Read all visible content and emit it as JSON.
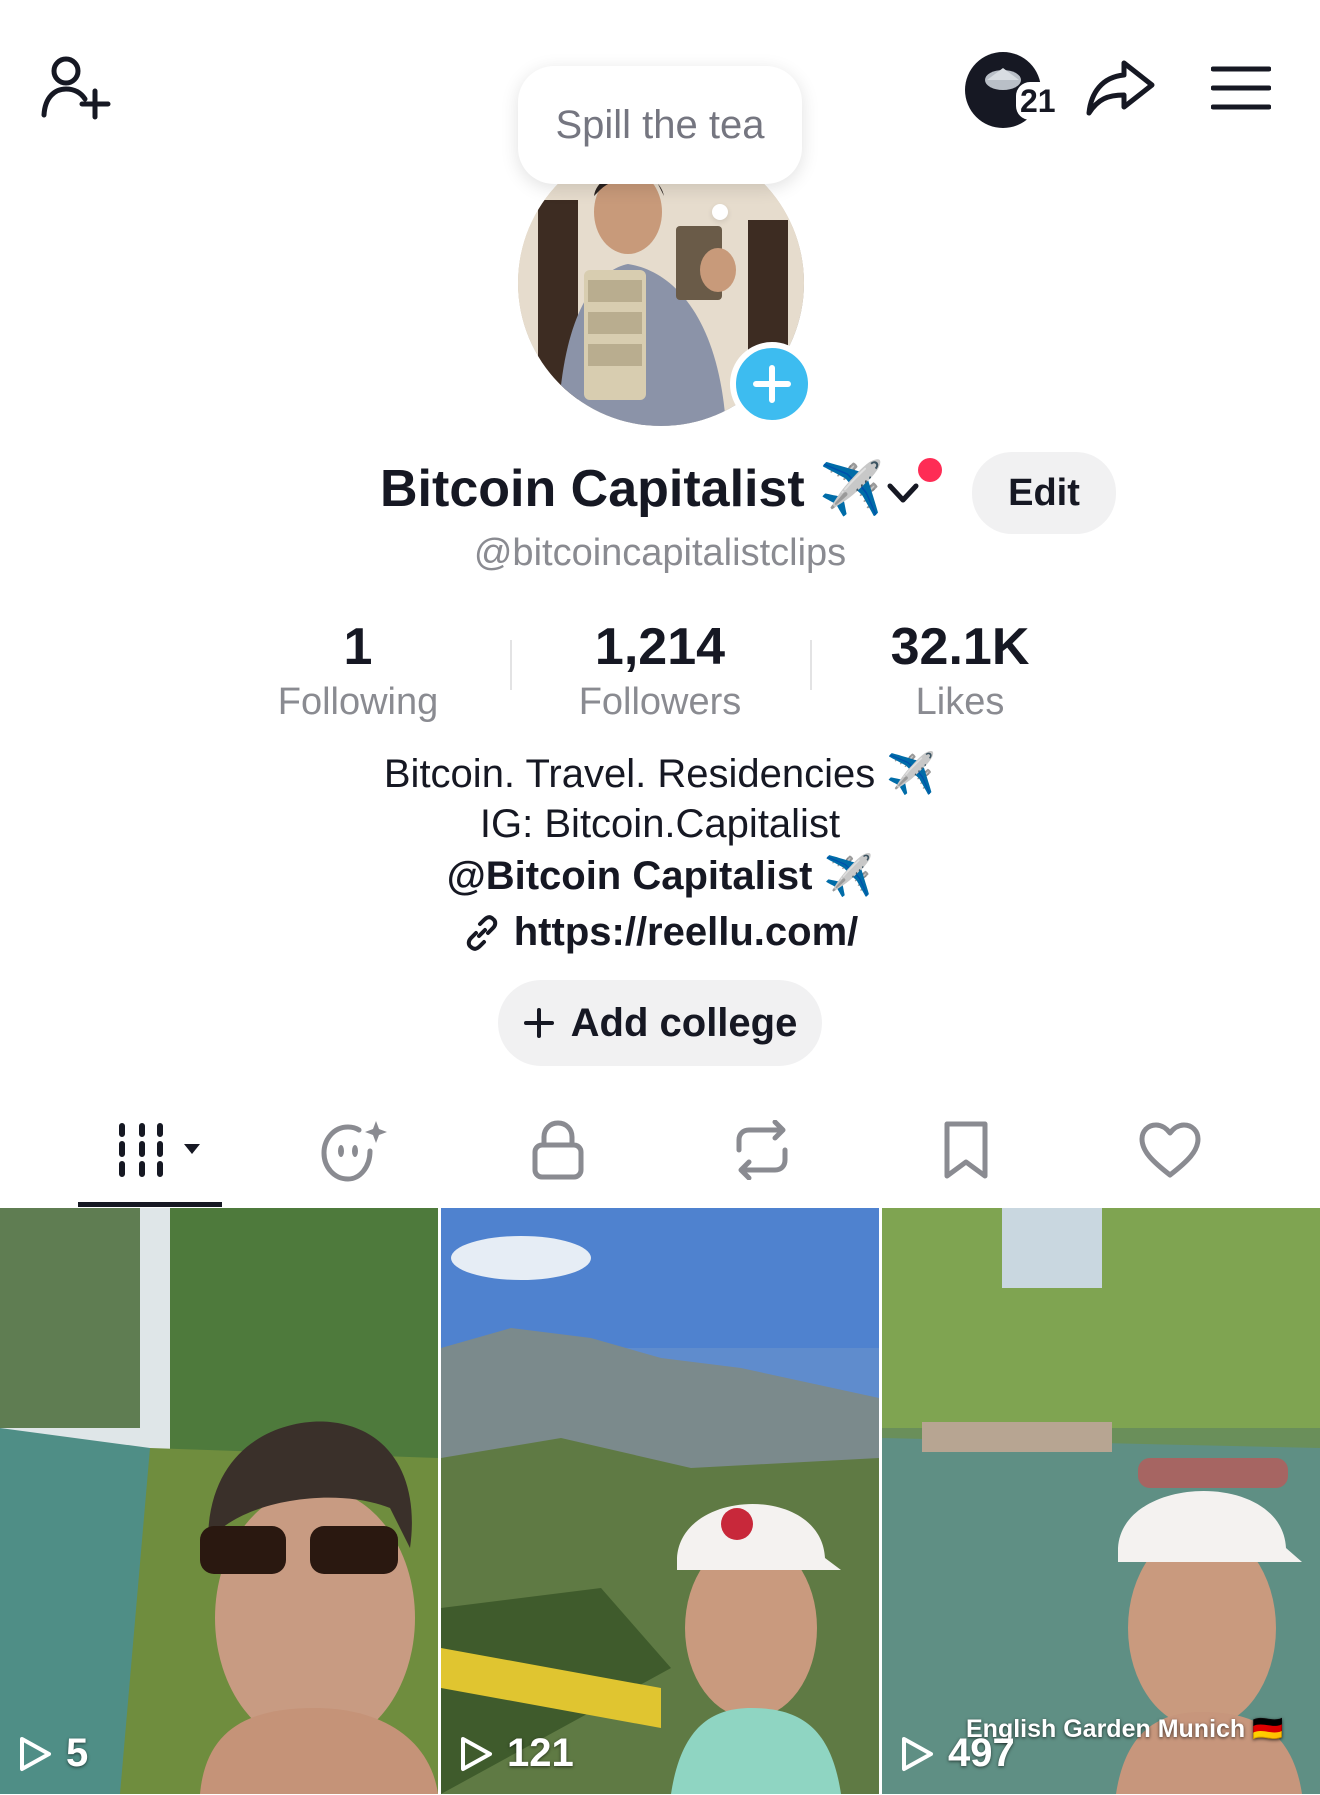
{
  "header": {
    "story_count": "21",
    "bubble_text": "Spill the tea"
  },
  "profile": {
    "display_name": "Bitcoin Capitalist ✈️",
    "edit_label": "Edit",
    "username": "@bitcoincapitalistclips"
  },
  "stats": [
    {
      "value": "1",
      "label": "Following"
    },
    {
      "value": "1,214",
      "label": "Followers"
    },
    {
      "value": "32.1K",
      "label": "Likes"
    }
  ],
  "bio": {
    "line1": "Bitcoin. Travel. Residencies ✈️",
    "line2": "IG: Bitcoin.Capitalist",
    "line3": "@Bitcoin Capitalist  ✈️",
    "link": "https://reellu.com/"
  },
  "add_college_label": "Add college",
  "tabs": [
    "videos",
    "reposts-ai",
    "private",
    "reposts",
    "saved",
    "liked"
  ],
  "videos": [
    {
      "views": "5",
      "caption": ""
    },
    {
      "views": "121",
      "caption": ""
    },
    {
      "views": "497",
      "caption": "English Garden Munich 🇩🇪"
    }
  ],
  "colors": {
    "accent": "#fe2c55",
    "plus_blue": "#3dbcf0",
    "text": "#161823",
    "muted": "#8a8b91"
  }
}
